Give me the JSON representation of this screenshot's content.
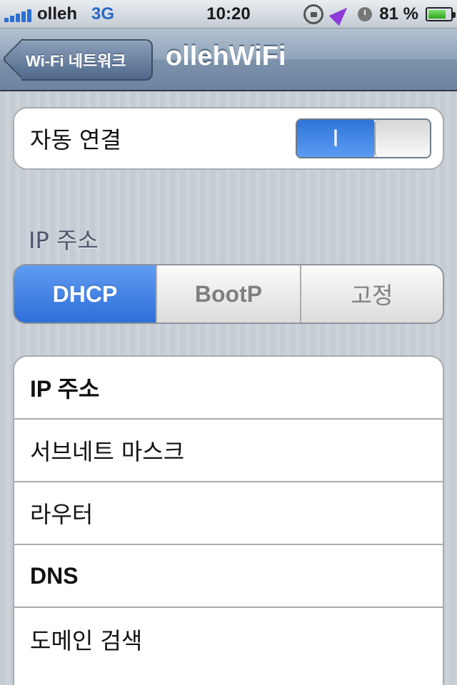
{
  "status_bar": {
    "carrier": "olleh",
    "network": "3G",
    "time": "10:20",
    "battery": "81 %",
    "battery_level": 0.81
  },
  "nav": {
    "back_label": "Wi-Fi 네트워크",
    "title": "ollehWiFi"
  },
  "auto_connect": {
    "label": "자동 연결",
    "toggle_on_text": "I",
    "toggle_state": true
  },
  "ip_section": {
    "header": "IP 주소",
    "segments": [
      "DHCP",
      "BootP",
      "고정"
    ],
    "selected_segment": "DHCP"
  },
  "ip_rows": [
    "IP 주소",
    "서브네트 마스크",
    "라우터",
    "DNS",
    "도메인 검색"
  ],
  "colors": {
    "accent": "#2e6ed8",
    "nav_bar": "#6d84a0",
    "location_icon": "#8e3ad8",
    "carrier_network": "#2a68c8"
  }
}
